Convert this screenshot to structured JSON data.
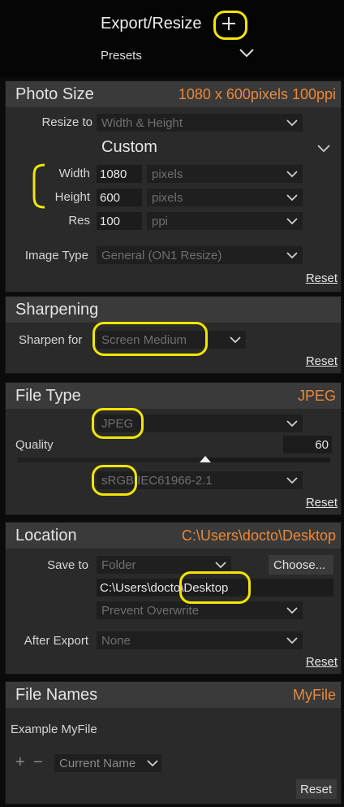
{
  "header": {
    "title": "Export/Resize",
    "add_icon": "plus-icon",
    "presets_label": "Presets"
  },
  "photo_size": {
    "title": "Photo Size",
    "summary": "1080 x 600pixels 100ppi",
    "resize_to_label": "Resize to",
    "resize_to_value": "Width & Height",
    "preset": "Custom",
    "width_label": "Width",
    "width_value": "1080",
    "width_unit": "pixels",
    "height_label": "Height",
    "height_value": "600",
    "height_unit": "pixels",
    "res_label": "Res",
    "res_value": "100",
    "res_unit": "ppi",
    "image_type_label": "Image Type",
    "image_type_value": "General (ON1 Resize)",
    "reset_label": "Reset"
  },
  "sharpening": {
    "title": "Sharpening",
    "sharpen_for_label": "Sharpen for",
    "sharpen_for_value": "Screen Medium",
    "reset_label": "Reset"
  },
  "file_type": {
    "title": "File Type",
    "summary": "JPEG",
    "format_value": "JPEG",
    "quality_label": "Quality",
    "quality_value": "60",
    "quality_fraction": 0.6,
    "color_profile": "sRGB IEC61966-2.1",
    "reset_label": "Reset"
  },
  "location": {
    "title": "Location",
    "summary": "C:\\Users\\docto\\Desktop",
    "save_to_label": "Save to",
    "save_to_value": "Folder",
    "choose_label": "Choose...",
    "path_value": "C:\\Users\\docto\\Desktop",
    "overwrite_value": "Prevent Overwrite",
    "after_export_label": "After Export",
    "after_export_value": "None",
    "reset_label": "Reset"
  },
  "file_names": {
    "title": "File Names",
    "summary": "MyFile",
    "example_label": "Example MyFile",
    "add_token": "+",
    "remove_token": "−",
    "token_value": "Current Name",
    "reset_label": "Reset"
  },
  "colors": {
    "accent": "#e8893a",
    "highlight": "#f2e600"
  }
}
